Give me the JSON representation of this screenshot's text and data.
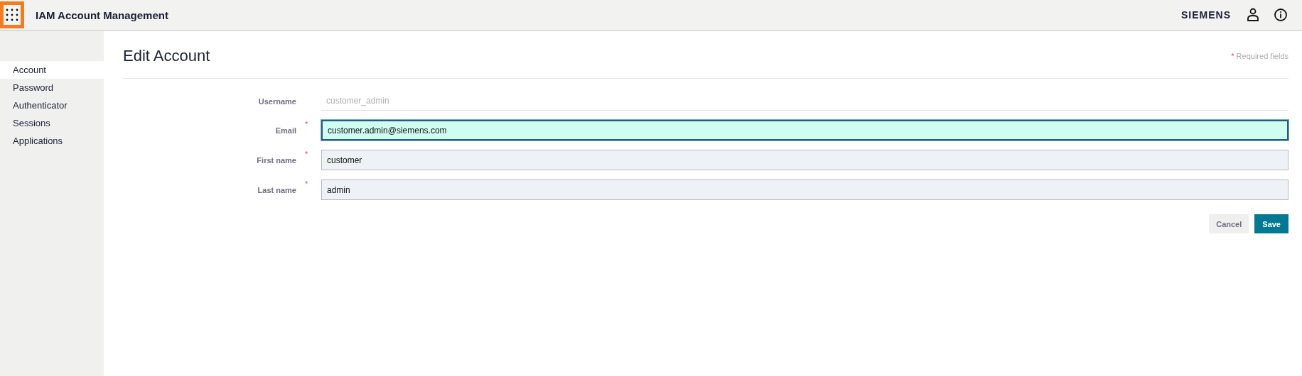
{
  "header": {
    "title": "IAM Account Management",
    "brand": "SIEMENS"
  },
  "sidebar": {
    "items": [
      {
        "label": "Account",
        "selected": true
      },
      {
        "label": "Password",
        "selected": false
      },
      {
        "label": "Authenticator",
        "selected": false
      },
      {
        "label": "Sessions",
        "selected": false
      },
      {
        "label": "Applications",
        "selected": false
      }
    ]
  },
  "page": {
    "title": "Edit Account",
    "required_note": "Required fields",
    "required_mark": "*"
  },
  "fields": [
    {
      "label": "Username",
      "kind": "readonly",
      "required": false,
      "value": "customer_admin"
    },
    {
      "label": "Email",
      "kind": "input",
      "required": true,
      "focused": true,
      "value": "customer.admin@siemens.com"
    },
    {
      "label": "First name",
      "kind": "input",
      "required": true,
      "focused": false,
      "value": "customer"
    },
    {
      "label": "Last name",
      "kind": "input",
      "required": true,
      "focused": false,
      "value": "admin"
    }
  ],
  "buttons": [
    {
      "label": "Cancel",
      "kind": "secondary"
    },
    {
      "label": "Save",
      "kind": "primary"
    }
  ]
}
